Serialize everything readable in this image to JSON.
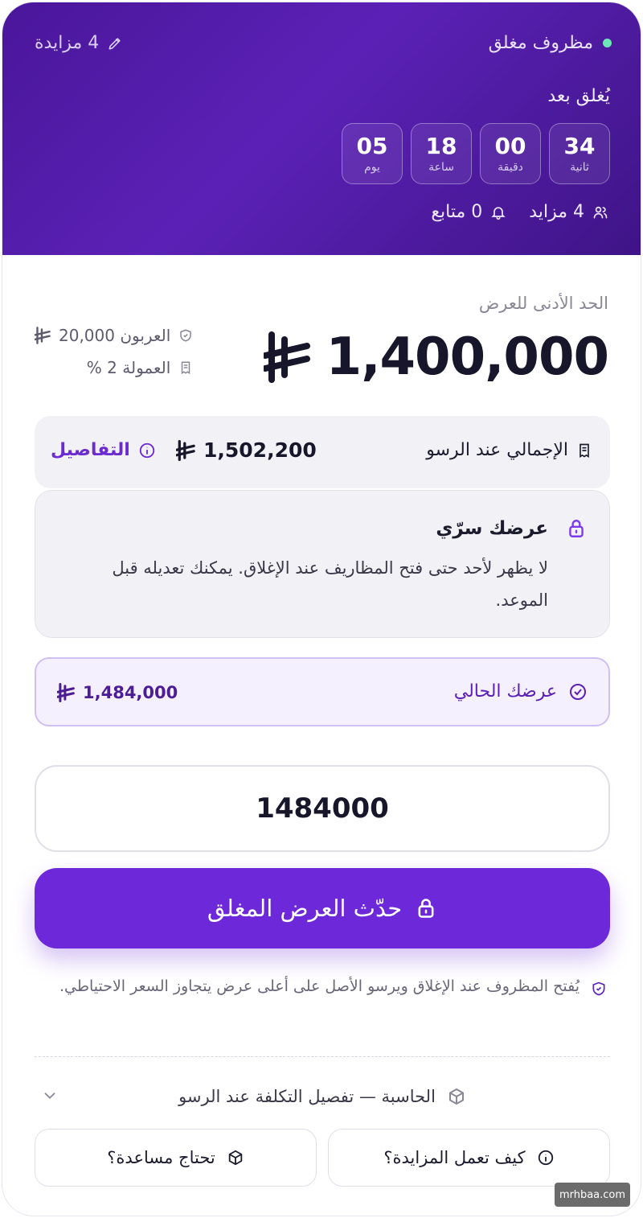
{
  "header": {
    "status": "مظروف مغلق",
    "bids_top": "4 مزايدة",
    "closes_label": "يُغلق بعد",
    "countdown": [
      {
        "value": "34",
        "unit": "ثانية"
      },
      {
        "value": "00",
        "unit": "دقيقة"
      },
      {
        "value": "18",
        "unit": "ساعة"
      },
      {
        "value": "05",
        "unit": "يوم"
      }
    ],
    "bidders": "4 مزايد",
    "followers": "0 متابع"
  },
  "pricing": {
    "min_label": "الحد الأدنى للعرض",
    "min_value": "1,400,000",
    "deposit": "العربون 20,000",
    "commission": "العمولة 2 %"
  },
  "total": {
    "label": "الإجمالي عند الرسو",
    "value": "1,502,200",
    "details": "التفاصيل"
  },
  "secret": {
    "title": "عرضك سرّي",
    "text": "لا يظهر لأحد حتى فتح المظاريف عند الإغلاق. يمكنك تعديله قبل الموعد."
  },
  "current": {
    "label": "عرضك الحالي",
    "value": "1,484,000"
  },
  "bid_input": {
    "value": "1484000"
  },
  "cta": {
    "label": "حدّث العرض المغلق"
  },
  "note": "يُفتح المظروف عند الإغلاق ويرسو الأصل على أعلى عرض يتجاوز السعر الاحتياطي.",
  "calculator": "الحاسبة — تفصيل التكلفة عند الرسو",
  "buttons": {
    "how": "كيف تعمل المزايدة؟",
    "help": "تحتاج مساعدة؟"
  },
  "watermark": "mrhbaa.com",
  "colors": {
    "primary": "#6d28d9",
    "hero": "#5b21b6",
    "status_dot": "#6ee7b7"
  }
}
